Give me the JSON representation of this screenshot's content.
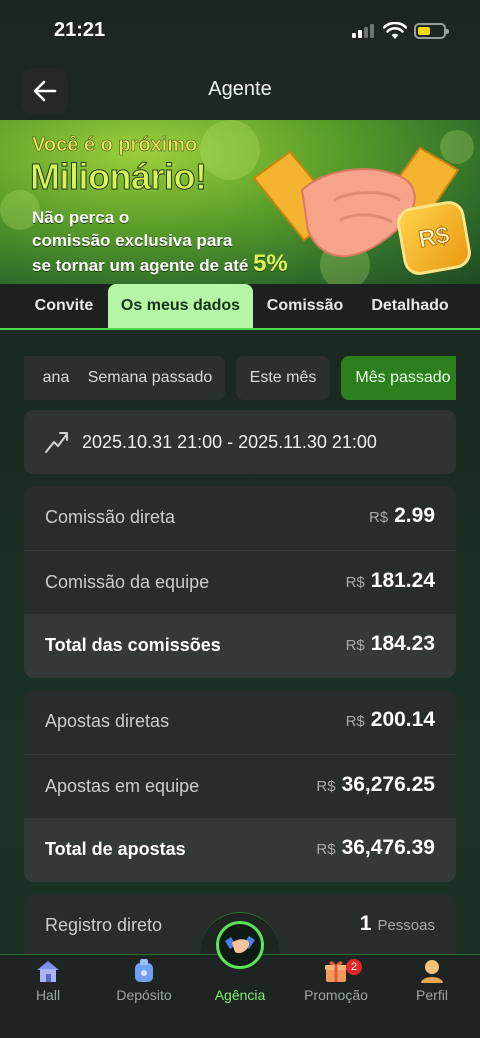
{
  "status_bar": {
    "time": "21:21"
  },
  "header": {
    "title": "Agente"
  },
  "banner": {
    "line1": "Você é o próximo",
    "line2": "Milionário!",
    "line3a": "Não perca o",
    "line3b": "comissão exclusiva para",
    "line3c": "se tornar um agente de até",
    "percent": "5%",
    "coin_text": "R$"
  },
  "tabs": [
    {
      "label": "Convite"
    },
    {
      "label": "Os meus dados"
    },
    {
      "label": "Comissão"
    },
    {
      "label": "Detalhado"
    }
  ],
  "filters": [
    {
      "label": "ana"
    },
    {
      "label": "Semana passado"
    },
    {
      "label": "Este mês"
    },
    {
      "label": "Mês passado"
    }
  ],
  "date_range": "2025.10.31 21:00 - 2025.11.30 21:00",
  "commissions": {
    "currency": "R$",
    "rows": [
      {
        "label": "Comissão direta",
        "value": "2.99"
      },
      {
        "label": "Comissão da equipe",
        "value": "181.24"
      },
      {
        "label": "Total das comissões",
        "value": "184.23"
      }
    ]
  },
  "bets": {
    "currency": "R$",
    "rows": [
      {
        "label": "Apostas diretas",
        "value": "200.14"
      },
      {
        "label": "Apostas em equipe",
        "value": "36,276.25"
      },
      {
        "label": "Total de apostas",
        "value": "36,476.39"
      }
    ]
  },
  "registrations": {
    "label": "Registro direto",
    "value": "1",
    "unit": "Pessoas"
  },
  "nav": [
    {
      "label": "Hall"
    },
    {
      "label": "Depósito"
    },
    {
      "label": "Agência"
    },
    {
      "label": "Promoção",
      "badge": "2"
    },
    {
      "label": "Perfil"
    }
  ],
  "colors": {
    "accent": "#4cd94c",
    "tab_active_bg": "#b7f5a6",
    "chip_active_bg": "#2c7f1d"
  }
}
